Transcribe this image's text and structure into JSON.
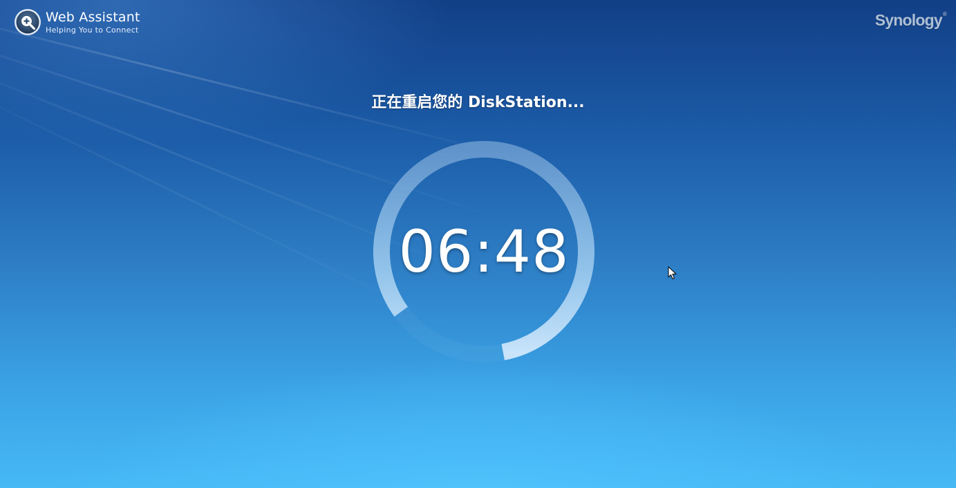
{
  "header": {
    "app_title": "Web Assistant",
    "app_subtitle": "Helping You to Connect",
    "vendor_logo": "Synology",
    "vendor_logo_mark": "®",
    "app_icon": "magnifier-plus-icon"
  },
  "main": {
    "status_text": "正在重启您的 DiskStation...",
    "countdown": "06:48",
    "ring_progress": 0.82
  },
  "colors": {
    "background_top": "#123f86",
    "background_bottom": "#46b9f5",
    "text": "#ffffff",
    "ring_track": "#9cc8ee",
    "vendor_logo": "#aebfd4"
  }
}
